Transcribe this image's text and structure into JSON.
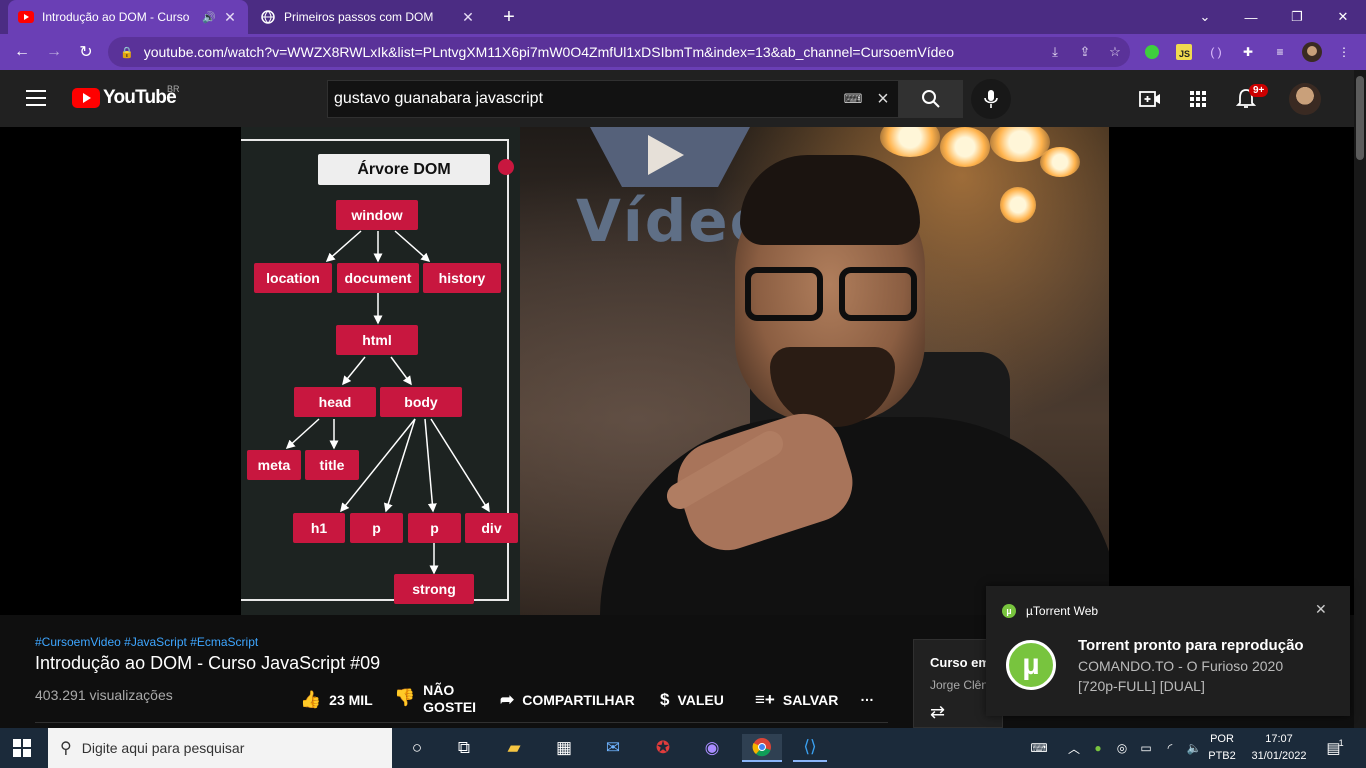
{
  "browser": {
    "tabs": [
      {
        "title": "Introdução ao DOM - Curso",
        "active": true
      },
      {
        "title": "Primeiros passos com DOM",
        "active": false
      }
    ],
    "url": "youtube.com/watch?v=WWZX8RWLxIk&list=PLntvgXM11X6pi7mW0O4ZmfUl1xDSIbmTm&index=13&ab_channel=CursoemVídeo"
  },
  "youtube": {
    "logo_text": "YouTube",
    "country": "BR",
    "search_value": "gustavo guanabara javascript",
    "notifications_count": "9+"
  },
  "video": {
    "board_title": "Árvore DOM",
    "nodes": {
      "window": "window",
      "location": "location",
      "document": "document",
      "history": "history",
      "html": "html",
      "head": "head",
      "body": "body",
      "meta": "meta",
      "title": "title",
      "h1": "h1",
      "p1": "p",
      "p2": "p",
      "div": "div",
      "strong": "strong"
    },
    "wall_logo": "Vídeo"
  },
  "info": {
    "hashtags": "#CursoemVideo #JavaScript #EcmaScript",
    "title": "Introdução ao DOM - Curso JavaScript #09",
    "views": "403.291 visualizações",
    "likes": "23 MIL",
    "dislike_line1": "NÃO",
    "dislike_line2": "GOSTEI",
    "share": "COMPARTILHAR",
    "thanks": "VALEU",
    "save": "SALVAR",
    "more": "…",
    "side_title": "Curso em",
    "side_author": "Jorge Clên"
  },
  "toast": {
    "app": "µTorrent Web",
    "heading": "Torrent pronto para reprodução",
    "line1": "COMANDO.TO - O Furioso 2020",
    "line2": "[720p-FULL] [DUAL]"
  },
  "taskbar": {
    "search_placeholder": "Digite aqui para pesquisar",
    "lang1": "POR",
    "lang2": "PTB2",
    "time": "17:07",
    "date": "31/01/2022",
    "notif_count": "1"
  }
}
